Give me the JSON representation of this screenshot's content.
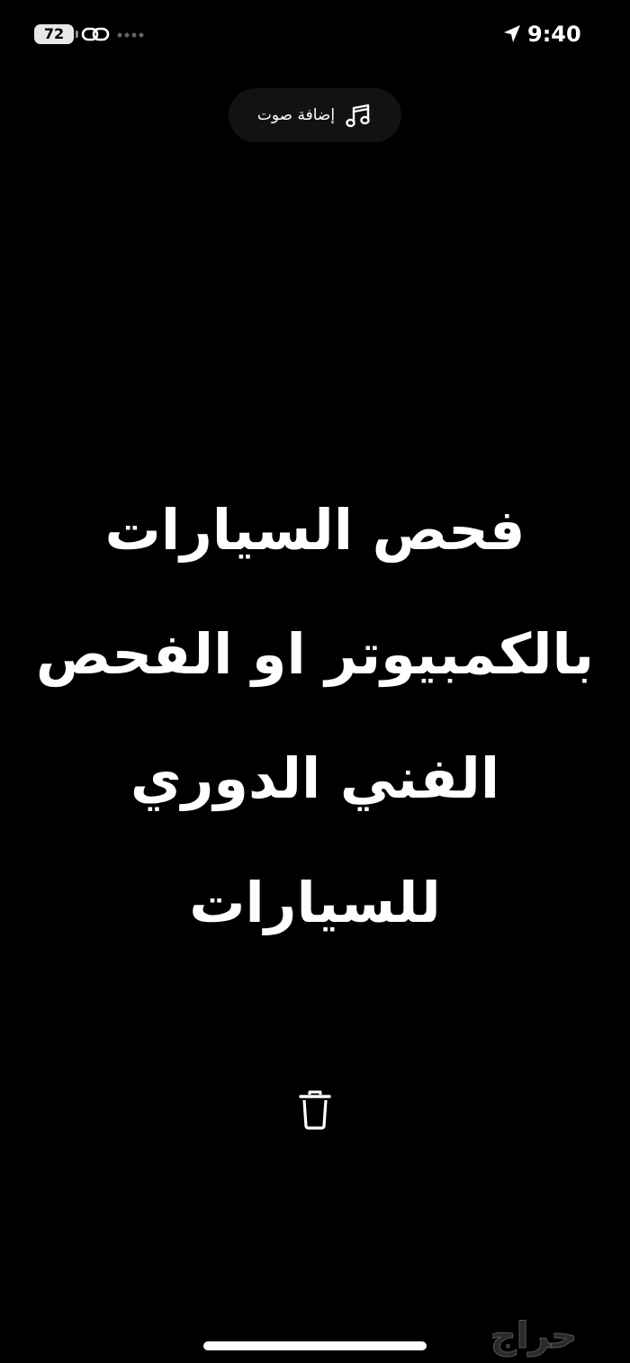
{
  "status_bar": {
    "battery_level": "72",
    "time": "9:40",
    "icons": [
      "link-icon",
      "signal-dots",
      "location-arrow-icon"
    ]
  },
  "add_sound": {
    "label": "إضافة صوت",
    "icon": "music-note-icon"
  },
  "headline": {
    "lines": [
      "فحص السيارات",
      "بالكمبيوتر او الفحص",
      "الفني الدوري",
      "للسيارات"
    ]
  },
  "delete": {
    "icon": "trash-icon"
  },
  "watermark": {
    "text": "حراج"
  }
}
